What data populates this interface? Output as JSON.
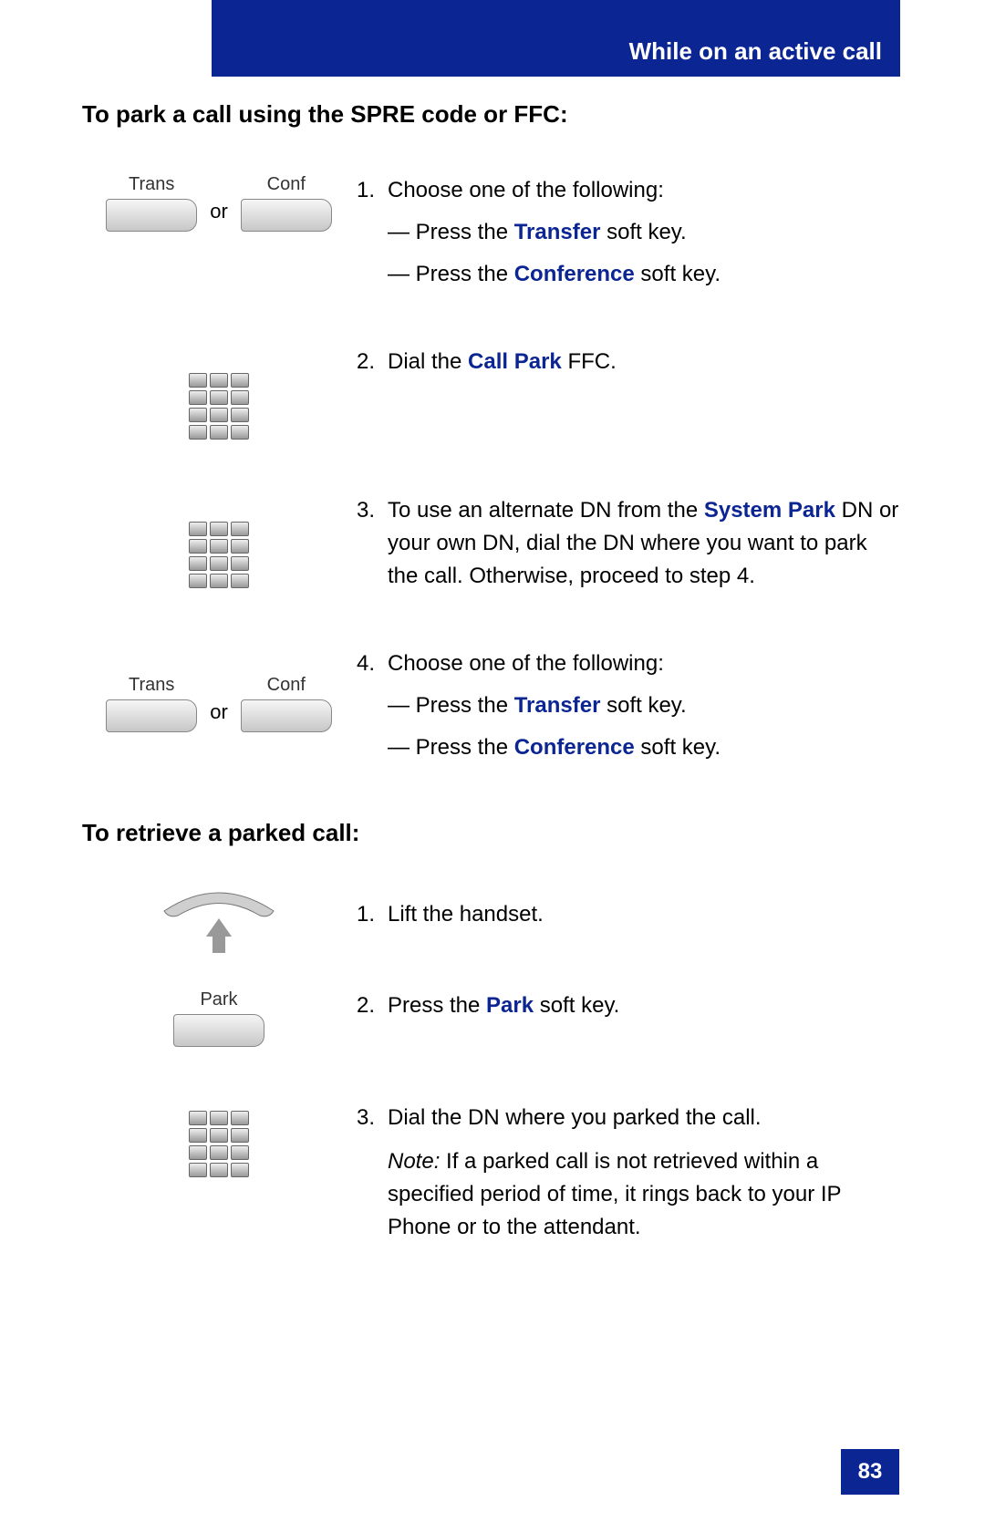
{
  "header": {
    "title": "While on an active call"
  },
  "section1": {
    "title": "To park a call using the SPRE code or FFC:",
    "step1": {
      "num": "1.",
      "text": "Choose one of the following:",
      "sub1_a": "— Press the ",
      "sub1_kw": "Transfer",
      "sub1_b": " soft key.",
      "sub2_a": "— Press the ",
      "sub2_kw": "Conference",
      "sub2_b": " soft key."
    },
    "trans_label": "Trans",
    "conf_label": "Conf",
    "or": "or",
    "step2": {
      "num": "2.",
      "a": "Dial the ",
      "kw": "Call Park",
      "b": " FFC."
    },
    "step3": {
      "num": "3.",
      "a": "To use an alternate DN from the ",
      "kw": "System Park",
      "b": " DN or your own DN, dial the DN where you want to park the call. Otherwise, proceed to step 4."
    },
    "step4": {
      "num": "4.",
      "text": "Choose one of the following:",
      "sub1_a": "— Press the ",
      "sub1_kw": "Transfer",
      "sub1_b": " soft key.",
      "sub2_a": "— Press the ",
      "sub2_kw": "Conference",
      "sub2_b": " soft key."
    }
  },
  "section2": {
    "title": "To retrieve a parked call:",
    "step1": {
      "num": "1.",
      "text": "Lift the handset."
    },
    "park_label": "Park",
    "step2": {
      "num": "2.",
      "a": "Press the ",
      "kw": "Park",
      "b": " soft key."
    },
    "step3": {
      "num": "3.",
      "text": "Dial the DN where you parked the call.",
      "note_lbl": "Note:",
      "note": " If a parked call is not retrieved within a specified period of time, it rings back to your IP Phone or to the attendant."
    }
  },
  "page_number": "83"
}
